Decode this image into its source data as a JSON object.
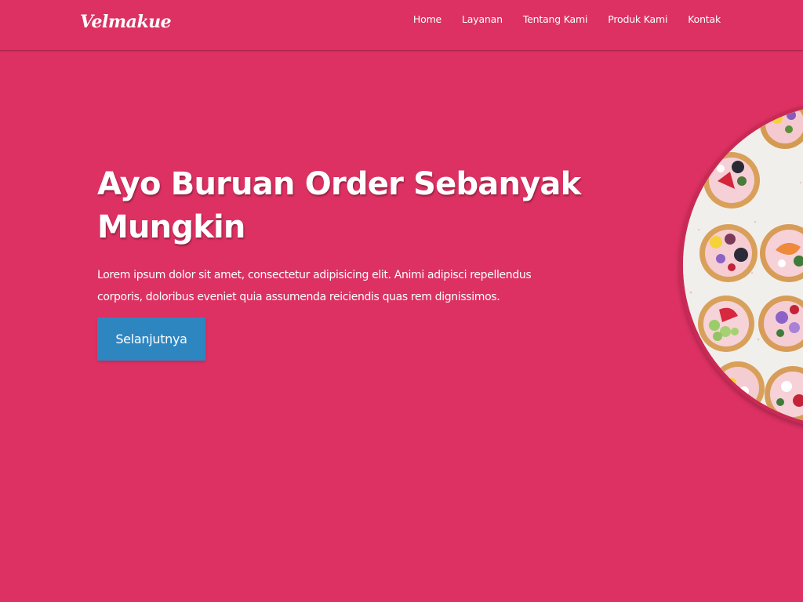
{
  "brand": {
    "name": "Velmakue"
  },
  "nav": {
    "items": [
      {
        "label": "Home"
      },
      {
        "label": "Layanan"
      },
      {
        "label": "Tentang Kami"
      },
      {
        "label": "Produk Kami"
      },
      {
        "label": "Kontak"
      }
    ]
  },
  "hero": {
    "title": "Ayo Buruan Order Sebanyak Mungkin",
    "text": "Lorem ipsum dolor sit amet, consectetur adipisicing elit. Animi adipisci repellendus corporis, doloribus eveniet quia assumenda reiciendis quas rem dignissimos.",
    "button_label": "Selanjutnya"
  },
  "colors": {
    "background": "#dc3162",
    "button": "#2e86c1",
    "text": "#ffffff"
  }
}
